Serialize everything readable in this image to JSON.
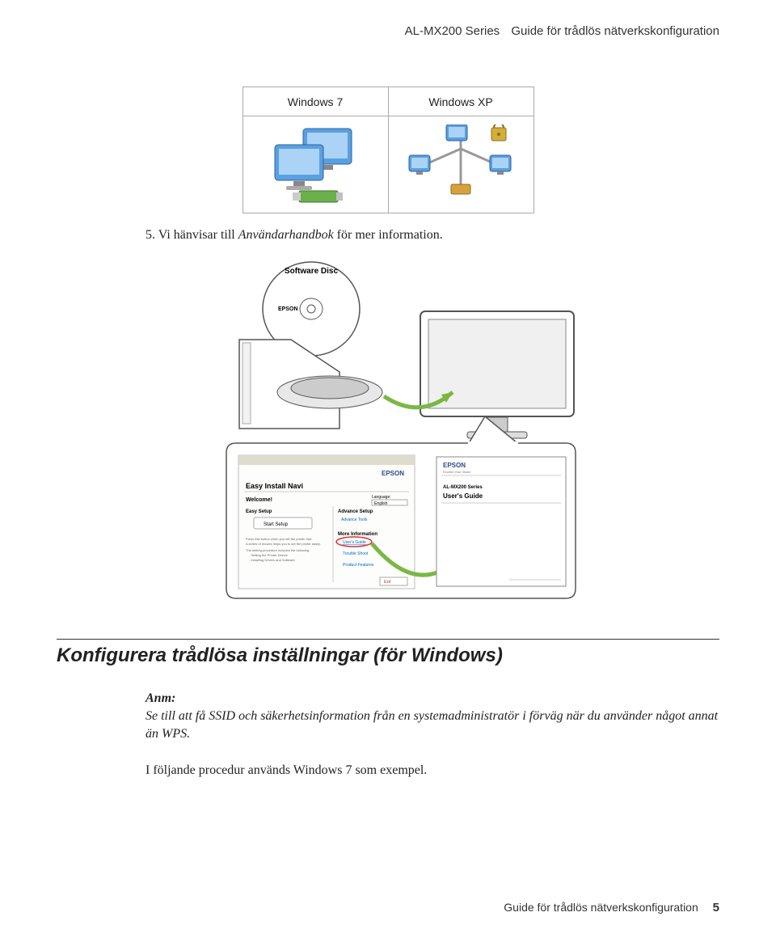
{
  "header": {
    "product": "AL-MX200 Series",
    "doc_title": "Guide för trådlös nätverkskonfiguration"
  },
  "os_table": {
    "col1": "Windows 7",
    "col2": "Windows XP"
  },
  "step5": {
    "number": "5.",
    "prefix": "Vi hänvisar till ",
    "emph": "Användarhandbok",
    "suffix": " för mer information."
  },
  "diagram": {
    "disc_label": "Software Disc",
    "disc_brand": "EPSON",
    "guide_series": "AL-MX200 Series",
    "guide_title": "User's Guide",
    "navi_brand": "EPSON",
    "navi_title": "Easy Install Navi",
    "navi_welcome": "Welcome!",
    "navi_lang_label": "Language:",
    "navi_lang_value": "English",
    "navi_easy_setup": "Easy Setup",
    "navi_start": "Start Setup",
    "navi_adv": "Advance Setup",
    "navi_adv_tools": "Advance Tools",
    "navi_more": "More Information",
    "navi_users_guide": "User's Guide",
    "navi_trouble": "Trouble Shoot",
    "navi_product": "Product Features",
    "navi_exit": "Exit",
    "navi_hint1": "Press this button when you set the printer first.",
    "navi_hint2": "A series of movies helps you to set the printer easily.",
    "navi_hint3": "The setting procedure includes the following.",
    "navi_hint4": "- Setting the Printer Device",
    "navi_hint5": "- Installing Drivers and Software"
  },
  "section": {
    "heading": "Konfigurera trådlösa inställningar (för Windows)",
    "note_label": "Anm:",
    "note_body": "Se till att få SSID och säkerhetsinformation från en systemadministratör i förväg när du använder något annat än WPS.",
    "proc": "I följande procedur används Windows 7 som exempel."
  },
  "footer": {
    "text": "Guide för trådlös nätverkskonfiguration",
    "page": "5"
  }
}
